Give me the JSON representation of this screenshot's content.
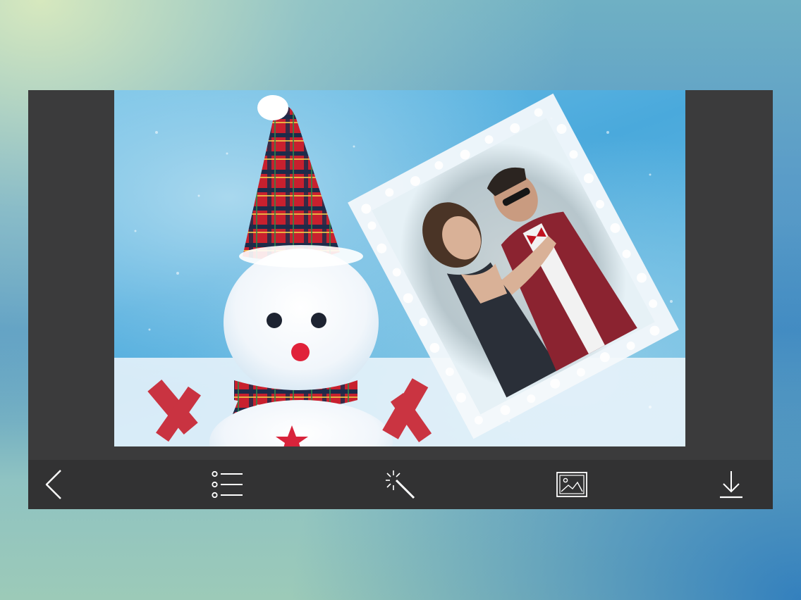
{
  "app": {
    "background_colors": [
      "#dce9bd",
      "#5a9cc8",
      "#2f7fc0",
      "#9ccab8"
    ],
    "panel_color": "#3b3b3c",
    "toolbar_color": "#323233"
  },
  "canvas": {
    "scene": "snowman",
    "frame_style": "snowflake-frame"
  },
  "toolbar": {
    "items": [
      {
        "icon": "back-chevron-icon"
      },
      {
        "icon": "list-icon"
      },
      {
        "icon": "magic-wand-icon"
      },
      {
        "icon": "image-icon"
      },
      {
        "icon": "download-icon"
      }
    ]
  }
}
